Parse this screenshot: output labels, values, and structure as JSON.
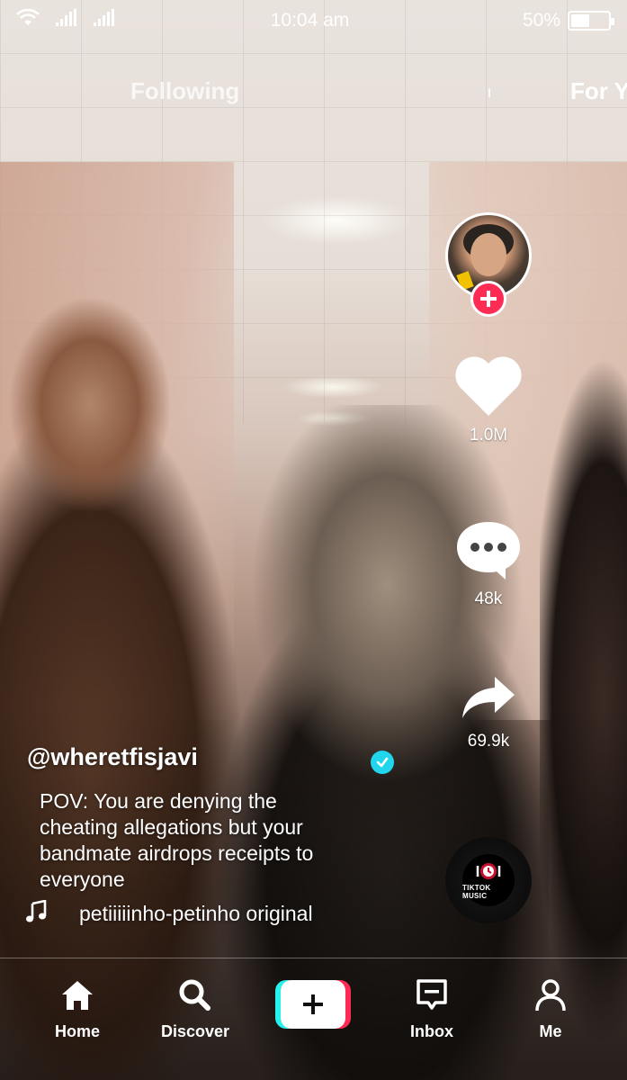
{
  "status_bar": {
    "time": "10:04 am",
    "battery": "50%",
    "battery_level": 0.5
  },
  "top_tabs": {
    "following": "Following",
    "for_you": "For Y"
  },
  "rail": {
    "likes": "1.0M",
    "comments": "48k",
    "shares": "69.9k"
  },
  "disc": {
    "label": "TIKTOK MUSIC"
  },
  "post": {
    "username": "@wheretfisjavi",
    "caption": "POV: You are denying the cheating allegations but your bandmate airdrops receipts to everyone",
    "sound": "petiiiiinho-petinho original"
  },
  "nav": {
    "home": "Home",
    "discover": "Discover",
    "inbox": "Inbox",
    "me": "Me"
  },
  "colors": {
    "accent_red": "#fe2c55",
    "accent_cyan": "#25f4ee",
    "verified_blue": "#20d5ec"
  }
}
